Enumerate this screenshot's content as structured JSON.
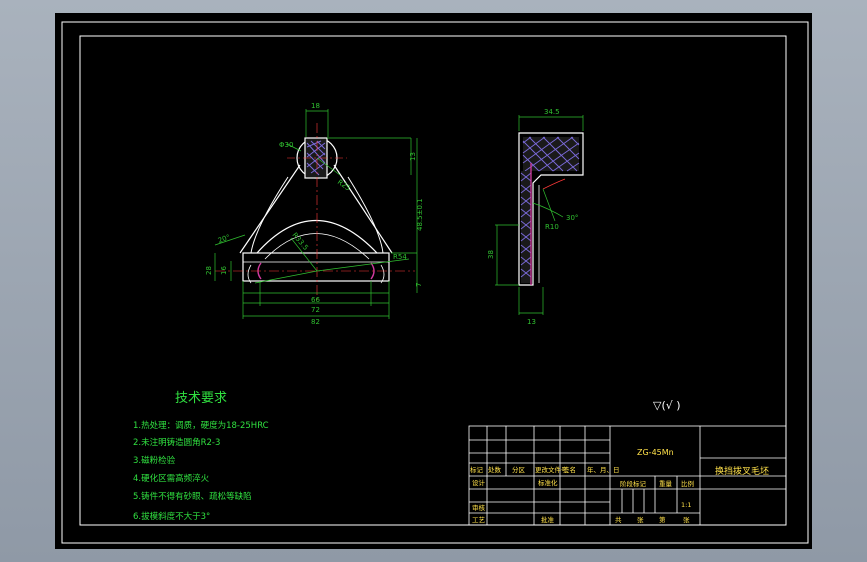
{
  "tech_requirements": {
    "title": "技术要求",
    "items": [
      "1.热处理：调质，硬度为18-25HRC",
      "2.未注明铸造圆角R2-3",
      "3.磁粉检验",
      "4.硬化区需高频淬火",
      "5.铸件不得有砂眼、疏松等缺陷",
      "6.拔模斜度不大于3°"
    ]
  },
  "roughness_symbol": "▽(√ )",
  "dimensions": {
    "front_top_width": "18",
    "front_hole_dia": "Φ30",
    "front_height_13": "13",
    "front_total_height": "48.5±0.1",
    "front_r": "R25",
    "front_r2": "R33.5",
    "front_r3": "R54",
    "front_left_angle": "20°",
    "front_left_16": "16",
    "front_left_28": "28",
    "front_right_7": "7",
    "front_bottom_66": "66",
    "front_bottom_72": "72",
    "front_bottom_82": "82",
    "side_top_width": "34.5",
    "side_angle": "30°",
    "side_r": "R10",
    "side_left_38": "38",
    "side_bottom_13": "13"
  },
  "title_block": {
    "material": "ZG-45Mn",
    "part_name": "换挡拨叉毛坯",
    "labels": [
      "标记",
      "处数",
      "分区",
      "更改文件号",
      "签名",
      "年、月、日"
    ],
    "design": "设计",
    "standardization": "标准化",
    "stage_mark": "阶段标记",
    "weight": "重量",
    "scale": "比例",
    "scale_value": "1:1",
    "review": "审核",
    "process": "工艺",
    "approve": "批准",
    "sheet_row": [
      "共",
      "张",
      "第",
      "张"
    ]
  }
}
